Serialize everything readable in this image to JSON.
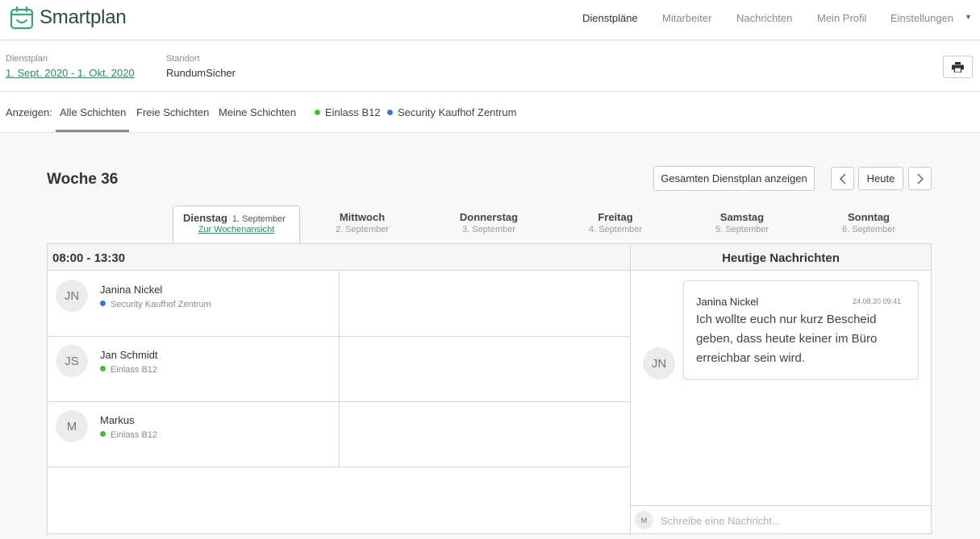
{
  "app": {
    "name": "Smartplan"
  },
  "nav": {
    "items": [
      {
        "label": "Dienstpläne",
        "active": true
      },
      {
        "label": "Mitarbeiter",
        "active": false
      },
      {
        "label": "Nachrichten",
        "active": false
      },
      {
        "label": "Mein Profil",
        "active": false
      },
      {
        "label": "Einstellungen",
        "active": false
      }
    ]
  },
  "info": {
    "plan_label": "Dienstplan",
    "plan_value": "1. Sept. 2020 - 1. Okt. 2020",
    "location_label": "Standort",
    "location_value": "RundumSicher"
  },
  "filter": {
    "label": "Anzeigen:",
    "tabs": [
      {
        "label": "Alle Schichten",
        "active": true
      },
      {
        "label": "Freie Schichten",
        "active": false
      },
      {
        "label": "Meine Schichten",
        "active": false
      }
    ],
    "locations": [
      {
        "label": "Einlass B12",
        "color": "#4cb83a"
      },
      {
        "label": "Security Kaufhof Zentrum",
        "color": "#3b73d9"
      }
    ]
  },
  "week": {
    "title": "Woche 36",
    "full_plan_button": "Gesamten Dienstplan anzeigen",
    "today_button": "Heute"
  },
  "days": [
    {
      "name": "Dienstag",
      "date": "1. September",
      "link": "Zur Wochenansicht",
      "active": true
    },
    {
      "name": "Mittwoch",
      "date": "2. September"
    },
    {
      "name": "Donnerstag",
      "date": "3. September"
    },
    {
      "name": "Freitag",
      "date": "4. September"
    },
    {
      "name": "Samstag",
      "date": "5. September"
    },
    {
      "name": "Sonntag",
      "date": "6. September"
    }
  ],
  "shift": {
    "time": "08:00 - 13:30",
    "people": [
      {
        "initials": "JN",
        "name": "Janina Nickel",
        "location": "Security Kaufhof Zentrum",
        "color": "#3b73d9"
      },
      {
        "initials": "JS",
        "name": "Jan Schmidt",
        "location": "Einlass B12",
        "color": "#4cb83a"
      },
      {
        "initials": "M",
        "name": "Markus",
        "location": "Einlass B12",
        "color": "#4cb83a"
      }
    ]
  },
  "messages": {
    "title": "Heutige Nachrichten",
    "items": [
      {
        "initials": "JN",
        "author": "Janina Nickel",
        "time": "24.08.20 09:41",
        "text": "Ich wollte euch nur kurz Bescheid geben, dass heute keiner im Büro erreichbar sein wird."
      }
    ],
    "compose_initials": "M",
    "compose_placeholder": "Schreibe eine Nachricht..."
  },
  "colors": {
    "brand": "#2a8a6e",
    "einlass": "#4cb83a",
    "security": "#3b73d9"
  }
}
